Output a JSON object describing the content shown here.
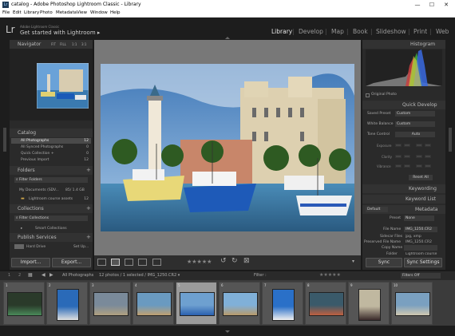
{
  "window": {
    "title": "catalog - Adobe Photoshop Lightroom Classic - Library",
    "minimize": "—",
    "maximize": "☐",
    "close": "✕"
  },
  "menu": [
    "File",
    "Edit",
    "Library",
    "Photo",
    "Metadata",
    "View",
    "Window",
    "Help"
  ],
  "identity": {
    "logo": "Lr",
    "catalog_label": "Adobe Lightroom Classic",
    "headline": "Get started with Lightroom ▸"
  },
  "modules": [
    "Library",
    "Develop",
    "Map",
    "Book",
    "Slideshow",
    "Print",
    "Web"
  ],
  "navigator": {
    "title": "Navigator",
    "zoom": [
      "FIT",
      "FILL",
      "1:1",
      "3:1"
    ]
  },
  "catalog": {
    "title": "Catalog",
    "items": [
      {
        "label": "All Photographs",
        "count": "12"
      },
      {
        "label": "All Synced Photographs",
        "count": "0"
      },
      {
        "label": "Quick Collection +",
        "count": "0"
      },
      {
        "label": "Previous Import",
        "count": "12"
      }
    ]
  },
  "folders": {
    "title": "Folders",
    "filter": "Filter Folders",
    "volume": "My Documents (SDV...",
    "volume_size": "85/ 1.4 GB",
    "folder": "Lightroom course assets",
    "folder_count": "12"
  },
  "collections": {
    "title": "Collections",
    "filter": "Filter Collections",
    "smart": "Smart Collections"
  },
  "publish": {
    "title": "Publish Services",
    "hard_drive": "Hard Drive",
    "hard_drive_action": "Set Up..."
  },
  "buttons": {
    "import": "Import...",
    "export": "Export...",
    "sync": "Sync",
    "sync_settings": "Sync Settings"
  },
  "histogram": {
    "title": "Histogram",
    "original_photo": "Original Photo"
  },
  "quick_develop": {
    "title": "Quick Develop",
    "saved_preset_label": "Saved Preset",
    "saved_preset_value": "Custom",
    "white_balance_label": "White Balance",
    "white_balance_value": "Custom",
    "tone_control_label": "Tone Control",
    "tone_control_value": "Auto",
    "sliders": [
      "Exposure",
      "Clarity",
      "Vibrance"
    ],
    "reset_all": "Reset All"
  },
  "keywording": {
    "title": "Keywording"
  },
  "keyword_list": {
    "title": "Keyword List"
  },
  "metadata": {
    "title": "Metadata",
    "preset_dropdown": "Default",
    "preset_label": "Preset",
    "preset_value": "None",
    "fields": [
      {
        "label": "File Name",
        "value": "IMG_1250.CR2"
      },
      {
        "label": "Sidecar Files",
        "value": "jpg, xmp"
      },
      {
        "label": "Preserved File Name",
        "value": "IMG_1250.CR2"
      },
      {
        "label": "Copy Name",
        "value": ""
      },
      {
        "label": "Folder",
        "value": "Lightroom course assets"
      }
    ]
  },
  "toolbar": {
    "stars": "★★★★★"
  },
  "filmstrip_bar": {
    "pages": [
      "1",
      "2"
    ],
    "source": "All Photographs",
    "status": "12 photos / 1 selected / IMG_1250.CR2 ▾",
    "filter_label": "Filter :",
    "stars": "★★★★★",
    "filter_dropdown": "Filters Off"
  },
  "thumbnails": [
    {
      "num": "1",
      "bg": "#2a3a2a",
      "accent": "#4a8a5a"
    },
    {
      "num": "2",
      "bg": "#2a6ab8",
      "accent": "#e0e0e0"
    },
    {
      "num": "3",
      "bg": "#7a8a9a",
      "accent": "#b0a080"
    },
    {
      "num": "4",
      "bg": "#6a9ac0",
      "accent": "#c0a070"
    },
    {
      "num": "5",
      "bg": "#6ea0d0",
      "accent": "#2a60b0"
    },
    {
      "num": "6",
      "bg": "#80b0d8",
      "accent": "#b89a6a"
    },
    {
      "num": "7",
      "bg": "#2a70c8",
      "accent": "#f0f0f0"
    },
    {
      "num": "8",
      "bg": "#3a5a6a",
      "accent": "#c06040"
    },
    {
      "num": "9",
      "bg": "#c0b8a0",
      "accent": "#3a2a2a"
    },
    {
      "num": "10",
      "bg": "#7aa0c0",
      "accent": "#d0c8b0"
    }
  ]
}
